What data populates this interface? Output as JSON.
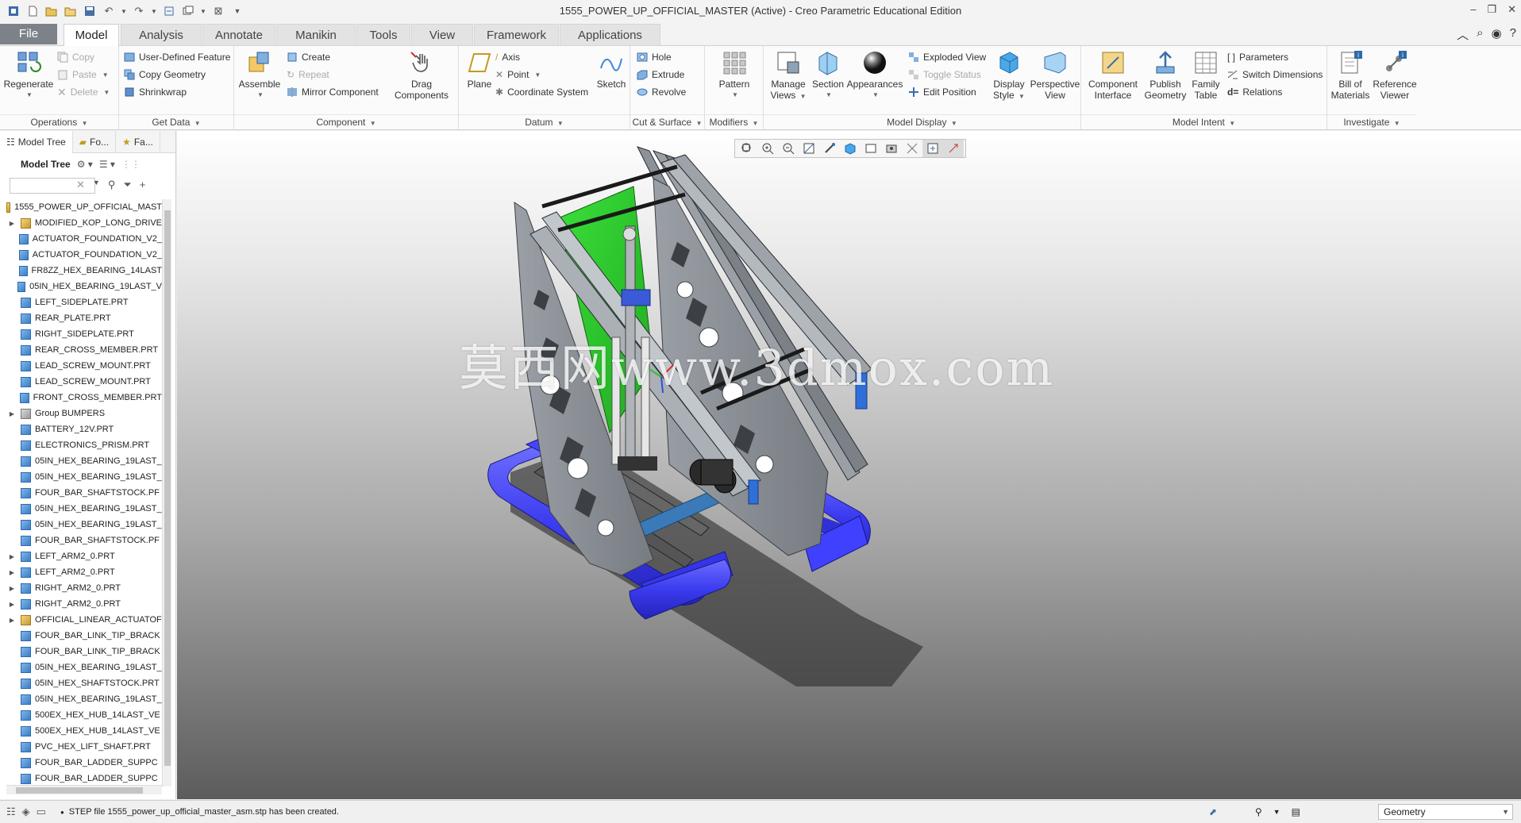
{
  "window": {
    "title": "1555_POWER_UP_OFFICIAL_MASTER (Active) - Creo Parametric Educational Edition"
  },
  "tabs": [
    {
      "label": "File"
    },
    {
      "label": "Model"
    },
    {
      "label": "Analysis"
    },
    {
      "label": "Annotate"
    },
    {
      "label": "Manikin"
    },
    {
      "label": "Tools"
    },
    {
      "label": "View"
    },
    {
      "label": "Framework"
    },
    {
      "label": "Applications"
    }
  ],
  "ribbon": {
    "operations": {
      "label": "Operations",
      "regenerate": "Regenerate",
      "copy": "Copy",
      "paste": "Paste",
      "delete": "Delete"
    },
    "get_data": {
      "label": "Get Data",
      "user_defined_feature": "User-Defined Feature",
      "copy_geometry": "Copy Geometry",
      "shrinkwrap": "Shrinkwrap"
    },
    "component": {
      "label": "Component",
      "assemble": "Assemble",
      "create": "Create",
      "repeat": "Repeat",
      "mirror_component": "Mirror Component",
      "drag_components_1": "Drag",
      "drag_components_2": "Components"
    },
    "datum": {
      "label": "Datum",
      "plane": "Plane",
      "axis": "Axis",
      "point": "Point",
      "coordinate_system": "Coordinate System",
      "sketch": "Sketch"
    },
    "cut_surface": {
      "label": "Cut & Surface",
      "hole": "Hole",
      "extrude": "Extrude",
      "revolve": "Revolve"
    },
    "modifiers": {
      "label": "Modifiers",
      "pattern": "Pattern"
    },
    "model_display": {
      "label": "Model Display",
      "manage_views_1": "Manage",
      "manage_views_2": "Views",
      "section": "Section",
      "appearances": "Appearances",
      "exploded_view": "Exploded View",
      "toggle_status": "Toggle Status",
      "edit_position": "Edit Position",
      "display_style_1": "Display",
      "display_style_2": "Style",
      "perspective_view_1": "Perspective",
      "perspective_view_2": "View"
    },
    "model_intent": {
      "label": "Model Intent",
      "component_interface_1": "Component",
      "component_interface_2": "Interface",
      "publish_geometry_1": "Publish",
      "publish_geometry_2": "Geometry",
      "family_table_1": "Family",
      "family_table_2": "Table",
      "parameters": "Parameters",
      "switch_dimensions": "Switch Dimensions",
      "relations": "Relations"
    },
    "investigate": {
      "label": "Investigate",
      "bill_of_materials_1": "Bill of",
      "bill_of_materials_2": "Materials",
      "reference_viewer_1": "Reference",
      "reference_viewer_2": "Viewer"
    }
  },
  "left_panel": {
    "tabs": [
      "Model Tree",
      "Fo...",
      "Fa..."
    ],
    "toolbar_title": "Model Tree",
    "search_placeholder": "",
    "tree_items": [
      {
        "label": "1555_POWER_UP_OFFICIAL_MAST",
        "type": "asm",
        "expandable": false,
        "root": true
      },
      {
        "label": "MODIFIED_KOP_LONG_DRIVE",
        "type": "asm",
        "expandable": true
      },
      {
        "label": "ACTUATOR_FOUNDATION_V2_",
        "type": "prt",
        "expandable": false
      },
      {
        "label": "ACTUATOR_FOUNDATION_V2_",
        "type": "prt",
        "expandable": false
      },
      {
        "label": "FR8ZZ_HEX_BEARING_14LAST",
        "type": "prt",
        "expandable": false
      },
      {
        "label": "05IN_HEX_BEARING_19LAST_V",
        "type": "prt",
        "expandable": false
      },
      {
        "label": "LEFT_SIDEPLATE.PRT",
        "type": "prt",
        "expandable": false
      },
      {
        "label": "REAR_PLATE.PRT",
        "type": "prt",
        "expandable": false
      },
      {
        "label": "RIGHT_SIDEPLATE.PRT",
        "type": "prt",
        "expandable": false
      },
      {
        "label": "REAR_CROSS_MEMBER.PRT",
        "type": "prt",
        "expandable": false
      },
      {
        "label": "LEAD_SCREW_MOUNT.PRT",
        "type": "prt",
        "expandable": false
      },
      {
        "label": "LEAD_SCREW_MOUNT.PRT",
        "type": "prt",
        "expandable": false
      },
      {
        "label": "FRONT_CROSS_MEMBER.PRT",
        "type": "prt",
        "expandable": false
      },
      {
        "label": "Group BUMPERS",
        "type": "grp",
        "expandable": true
      },
      {
        "label": "BATTERY_12V.PRT",
        "type": "prt",
        "expandable": false
      },
      {
        "label": "ELECTRONICS_PRISM.PRT",
        "type": "prt",
        "expandable": false
      },
      {
        "label": "05IN_HEX_BEARING_19LAST_",
        "type": "prt",
        "expandable": false
      },
      {
        "label": "05IN_HEX_BEARING_19LAST_",
        "type": "prt",
        "expandable": false
      },
      {
        "label": "FOUR_BAR_SHAFTSTOCK.PF",
        "type": "prt",
        "expandable": false
      },
      {
        "label": "05IN_HEX_BEARING_19LAST_",
        "type": "prt",
        "expandable": false
      },
      {
        "label": "05IN_HEX_BEARING_19LAST_",
        "type": "prt",
        "expandable": false
      },
      {
        "label": "FOUR_BAR_SHAFTSTOCK.PF",
        "type": "prt",
        "expandable": false
      },
      {
        "label": "LEFT_ARM2_0.PRT",
        "type": "prt",
        "expandable": true
      },
      {
        "label": "LEFT_ARM2_0.PRT",
        "type": "prt",
        "expandable": true
      },
      {
        "label": "RIGHT_ARM2_0.PRT",
        "type": "prt",
        "expandable": true
      },
      {
        "label": "RIGHT_ARM2_0.PRT",
        "type": "prt",
        "expandable": true
      },
      {
        "label": "OFFICIAL_LINEAR_ACTUATOF",
        "type": "asm",
        "expandable": true
      },
      {
        "label": "FOUR_BAR_LINK_TIP_BRACK",
        "type": "prt",
        "expandable": false
      },
      {
        "label": "FOUR_BAR_LINK_TIP_BRACK",
        "type": "prt",
        "expandable": false
      },
      {
        "label": "05IN_HEX_BEARING_19LAST_",
        "type": "prt",
        "expandable": false
      },
      {
        "label": "05IN_HEX_SHAFTSTOCK.PRT",
        "type": "prt",
        "expandable": false
      },
      {
        "label": "05IN_HEX_BEARING_19LAST_",
        "type": "prt",
        "expandable": false
      },
      {
        "label": "500EX_HEX_HUB_14LAST_VE",
        "type": "prt",
        "expandable": false
      },
      {
        "label": "500EX_HEX_HUB_14LAST_VE",
        "type": "prt",
        "expandable": false
      },
      {
        "label": "PVC_HEX_LIFT_SHAFT.PRT",
        "type": "prt",
        "expandable": false
      },
      {
        "label": "FOUR_BAR_LADDER_SUPPC",
        "type": "prt",
        "expandable": false
      },
      {
        "label": "FOUR_BAR_LADDER_SUPPC",
        "type": "prt",
        "expandable": false
      }
    ]
  },
  "viewport": {
    "watermark": "莫西网www.3dmox.com"
  },
  "status": {
    "message": "STEP file 1555_power_up_official_master_asm.stp has been created.",
    "filter_value": "Geometry"
  },
  "colors": {
    "file_tab": "#7d8288",
    "bumper_blue": "#3b3bff",
    "plate_green": "#2ecc2e",
    "frame_gray": "#8a8f96"
  }
}
